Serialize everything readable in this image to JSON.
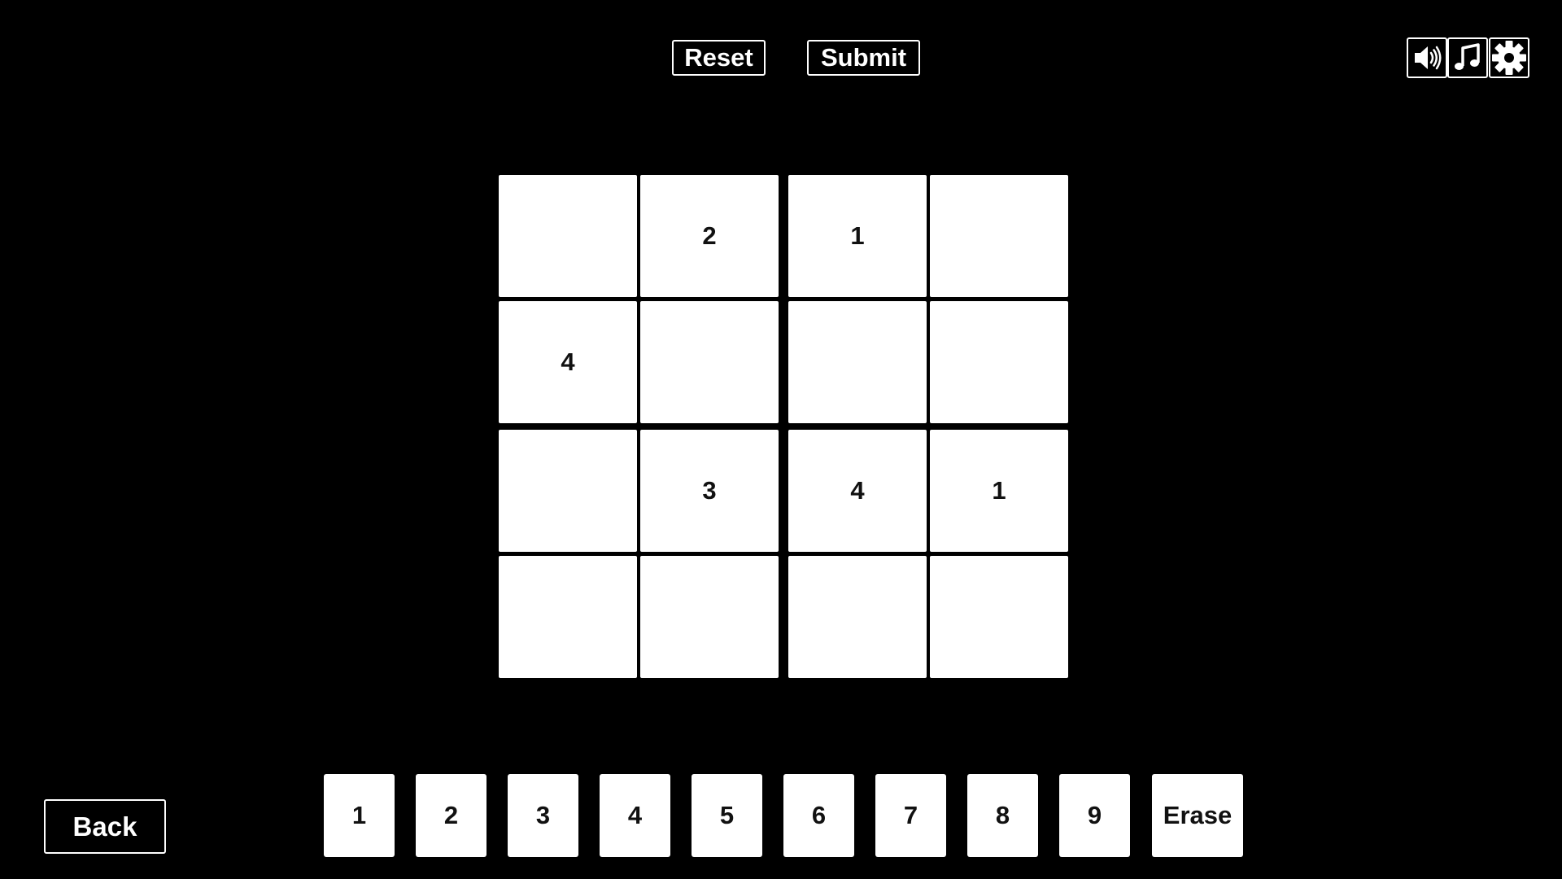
{
  "toolbar": {
    "reset_label": "Reset",
    "submit_label": "Submit"
  },
  "icons": {
    "sound": "speaker-icon",
    "music": "music-note-icon",
    "settings": "gear-icon"
  },
  "grid": {
    "rows": 4,
    "cols": 4,
    "cells": [
      [
        "",
        "2",
        "1",
        ""
      ],
      [
        "4",
        "",
        "",
        ""
      ],
      [
        "",
        "3",
        "4",
        "1"
      ],
      [
        "",
        "",
        "",
        ""
      ]
    ]
  },
  "keypad": {
    "numbers": [
      "1",
      "2",
      "3",
      "4",
      "5",
      "6",
      "7",
      "8",
      "9"
    ],
    "erase_label": "Erase"
  },
  "navigation": {
    "back_label": "Back"
  },
  "colors": {
    "background": "#000000",
    "foreground": "#ffffff",
    "cell_text": "#111111"
  }
}
